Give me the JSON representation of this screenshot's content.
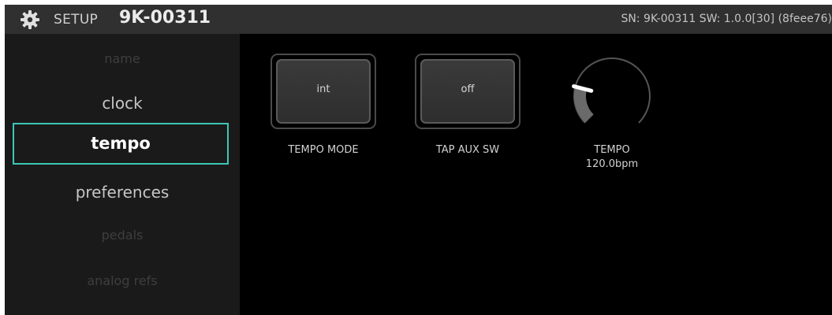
{
  "header": {
    "section_label": "SETUP",
    "device_id": "9K-00311",
    "serial_info": "SN: 9K-00311 SW: 1.0.0[30] (8feee76)"
  },
  "sidebar": {
    "items": [
      {
        "label": "name",
        "state": "dim"
      },
      {
        "label": "clock",
        "state": "normal"
      },
      {
        "label": "tempo",
        "state": "active"
      },
      {
        "label": "preferences",
        "state": "normal"
      },
      {
        "label": "pedals",
        "state": "dim"
      },
      {
        "label": "analog refs",
        "state": "dim"
      }
    ]
  },
  "controls": {
    "tempo_mode": {
      "value": "int",
      "label": "TEMPO MODE"
    },
    "tap_aux_sw": {
      "value": "off",
      "label": "TAP AUX SW"
    },
    "tempo": {
      "label": "TEMPO",
      "value": "120.0bpm",
      "level": 0.22
    }
  },
  "colors": {
    "accent": "#3ec7b4",
    "background": "#000000",
    "topbar": "#303030",
    "sidebar": "#1a1a1a"
  },
  "icons": {
    "settings": "gear-icon"
  }
}
